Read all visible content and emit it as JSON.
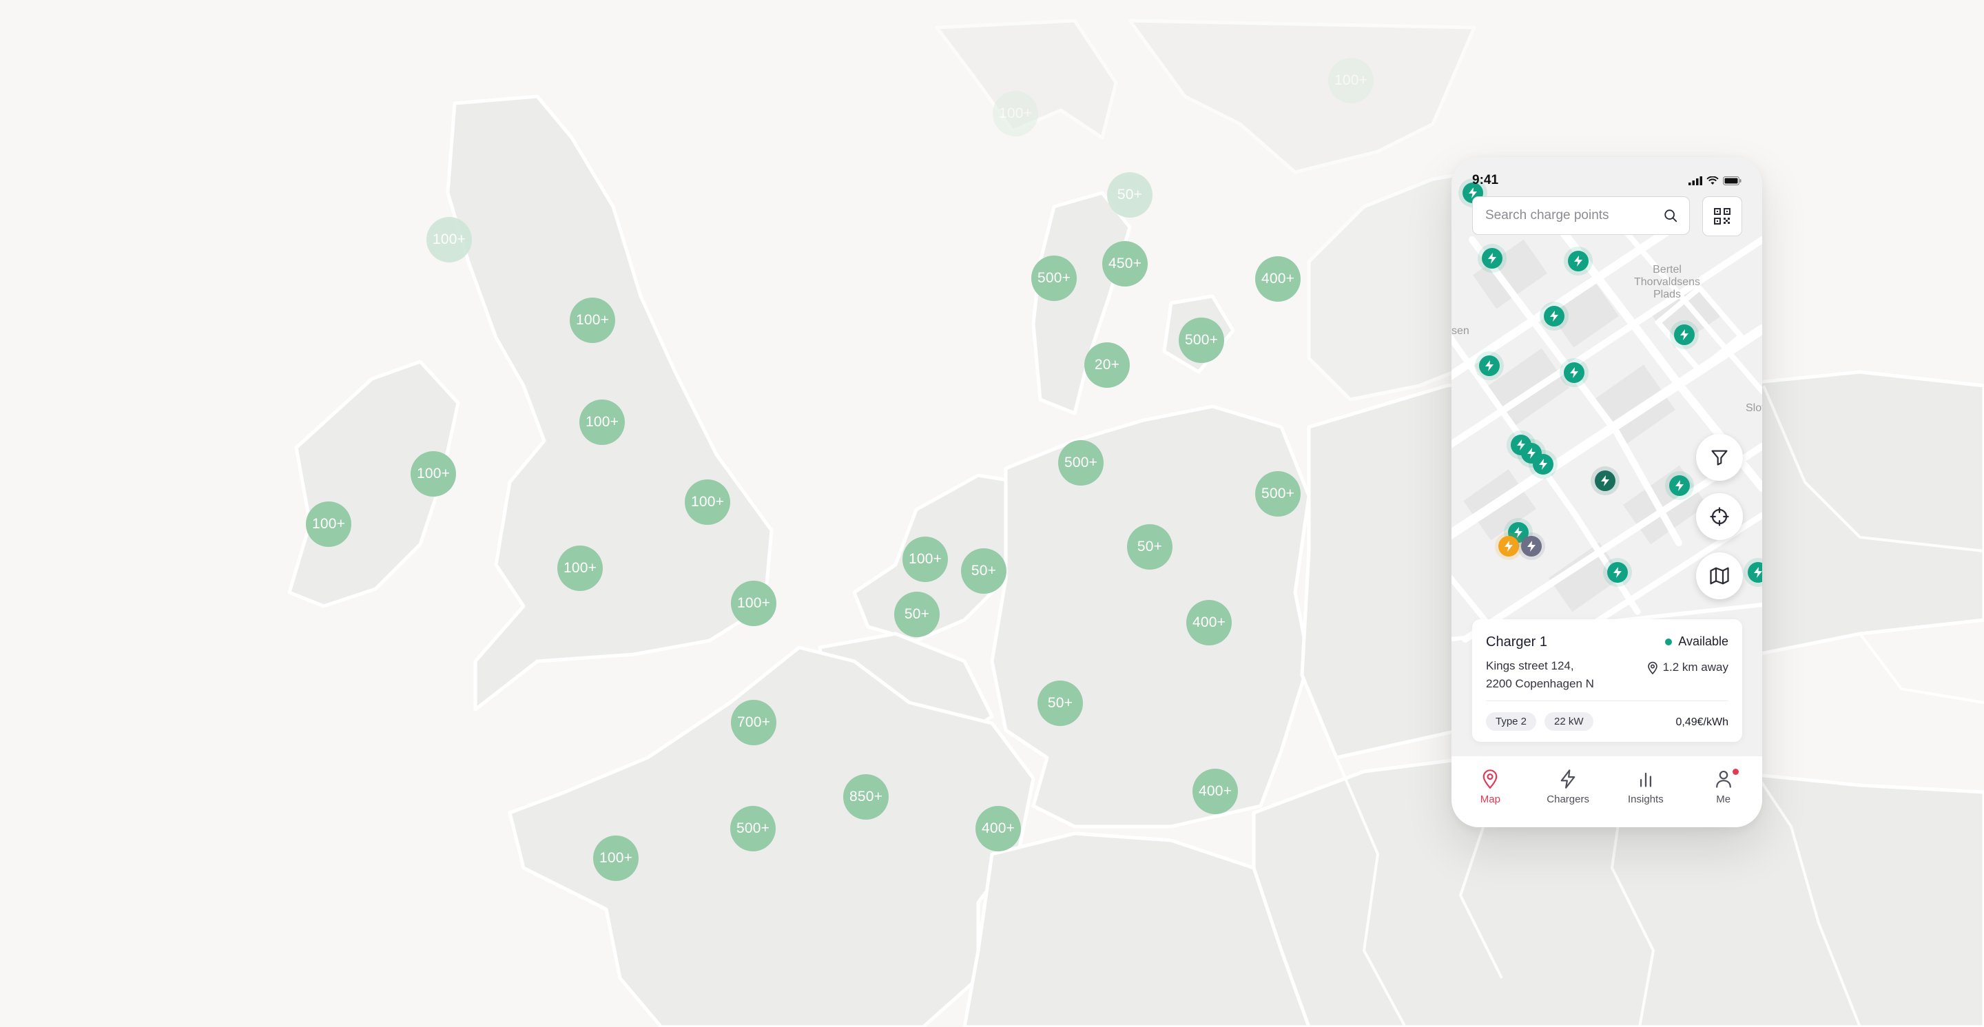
{
  "colors": {
    "cluster": "#96cba8",
    "accent": "#e23a55",
    "charger_available": "#11a183",
    "charger_busy": "#f2a31b",
    "charger_offline": "#6c6f86"
  },
  "background_map": {
    "clusters": [
      {
        "label": "100+",
        "style": "ghost"
      },
      {
        "label": "100+",
        "style": "ghost"
      },
      {
        "label": "100+",
        "style": "faded"
      },
      {
        "label": "50+",
        "style": "faded"
      },
      {
        "label": "500+",
        "style": "normal"
      },
      {
        "label": "450+",
        "style": "normal"
      },
      {
        "label": "400+",
        "style": "normal"
      },
      {
        "label": "100+",
        "style": "normal"
      },
      {
        "label": "500+",
        "style": "normal"
      },
      {
        "label": "20+",
        "style": "normal"
      },
      {
        "label": "100+",
        "style": "normal"
      },
      {
        "label": "100+",
        "style": "normal"
      },
      {
        "label": "500+",
        "style": "normal"
      },
      {
        "label": "100+",
        "style": "normal"
      },
      {
        "label": "100+",
        "style": "normal"
      },
      {
        "label": "500+",
        "style": "normal"
      },
      {
        "label": "100+",
        "style": "normal"
      },
      {
        "label": "100+",
        "style": "normal"
      },
      {
        "label": "50+",
        "style": "normal"
      },
      {
        "label": "50+",
        "style": "normal"
      },
      {
        "label": "100+",
        "style": "normal"
      },
      {
        "label": "50+",
        "style": "normal"
      },
      {
        "label": "400+",
        "style": "normal"
      },
      {
        "label": "700+",
        "style": "normal"
      },
      {
        "label": "50+",
        "style": "normal"
      },
      {
        "label": "850+",
        "style": "normal"
      },
      {
        "label": "400+",
        "style": "normal"
      },
      {
        "label": "500+",
        "style": "normal"
      },
      {
        "label": "400+",
        "style": "normal"
      },
      {
        "label": "100+",
        "style": "normal"
      }
    ]
  },
  "phone": {
    "status_bar": {
      "time": "9:41"
    },
    "search": {
      "placeholder": "Search charge points",
      "icon": "search-icon"
    },
    "qr_button": {
      "icon": "qr-code-icon"
    },
    "map_labels": [
      "Bertel\nThorvaldsens\nPlads",
      "sen",
      "Slot"
    ],
    "map_controls": [
      {
        "name": "filter-button",
        "icon": "filter-icon"
      },
      {
        "name": "locate-button",
        "icon": "crosshair-icon"
      },
      {
        "name": "map-layers-button",
        "icon": "map-icon"
      }
    ],
    "charger_card": {
      "title": "Charger 1",
      "status": "Available",
      "address_line1": "Kings street 124,",
      "address_line2": "2200 Copenhagen N",
      "distance": "1.2 km away",
      "connector": "Type 2",
      "power": "22 kW",
      "price": "0,49€/kWh"
    },
    "tabs": [
      {
        "label": "Map",
        "icon": "map-pin-icon",
        "active": true
      },
      {
        "label": "Chargers",
        "icon": "lightning-icon",
        "active": false
      },
      {
        "label": "Insights",
        "icon": "bar-chart-icon",
        "active": false
      },
      {
        "label": "Me",
        "icon": "user-icon",
        "active": false,
        "badge": true
      }
    ]
  }
}
